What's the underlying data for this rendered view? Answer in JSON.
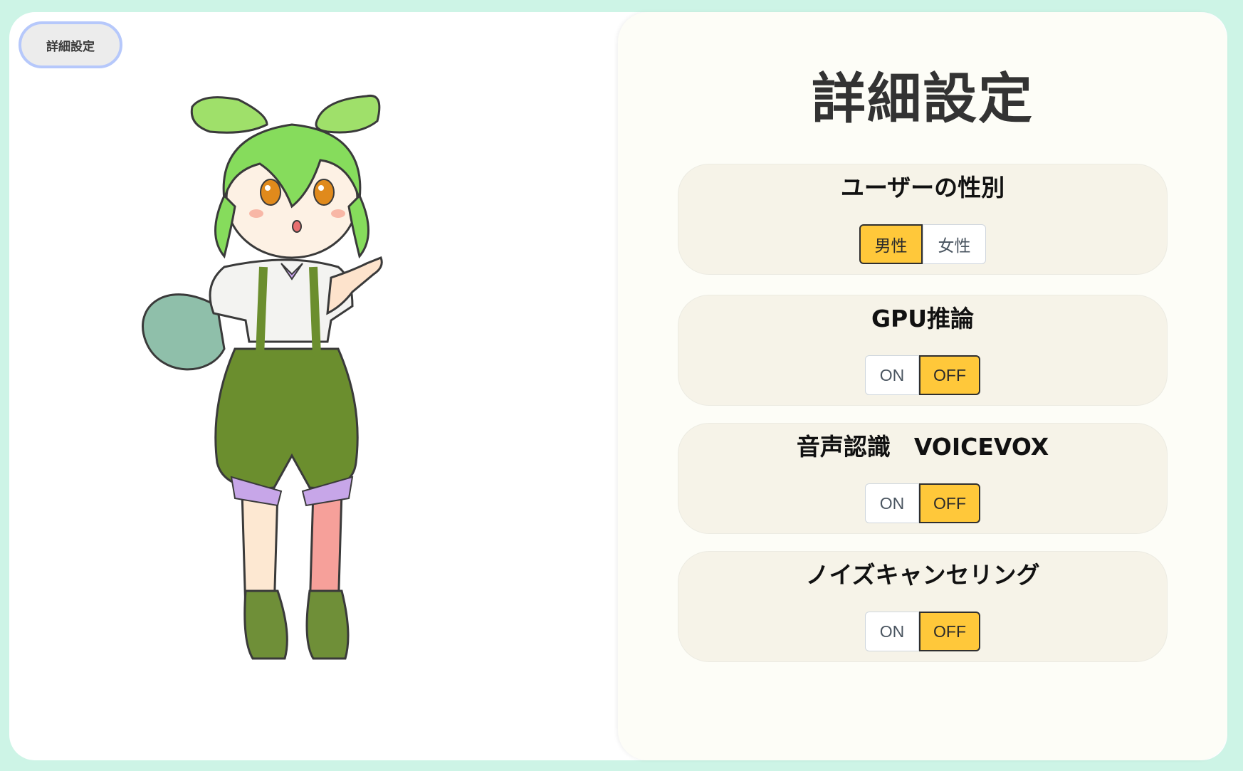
{
  "top_button": {
    "label": "詳細設定"
  },
  "character_image": {
    "name": "zundamon-character"
  },
  "panel": {
    "title": "詳細設定",
    "settings": [
      {
        "title": "ユーザーの性別",
        "options": [
          "男性",
          "女性"
        ],
        "selected": "男性"
      },
      {
        "title": "GPU推論",
        "options": [
          "ON",
          "OFF"
        ],
        "selected": "OFF"
      },
      {
        "title": "音声認識　VOICEVOX",
        "options": [
          "ON",
          "OFF"
        ],
        "selected": "OFF"
      },
      {
        "title": "ノイズキャンセリング",
        "options": [
          "ON",
          "OFF"
        ],
        "selected": "OFF"
      }
    ]
  },
  "colors": {
    "background": "#cdf4e6",
    "panel": "#fdfdf7",
    "card": "#f6f3e8",
    "active": "#ffc83a",
    "top_button_border": "#b6c8fb"
  }
}
